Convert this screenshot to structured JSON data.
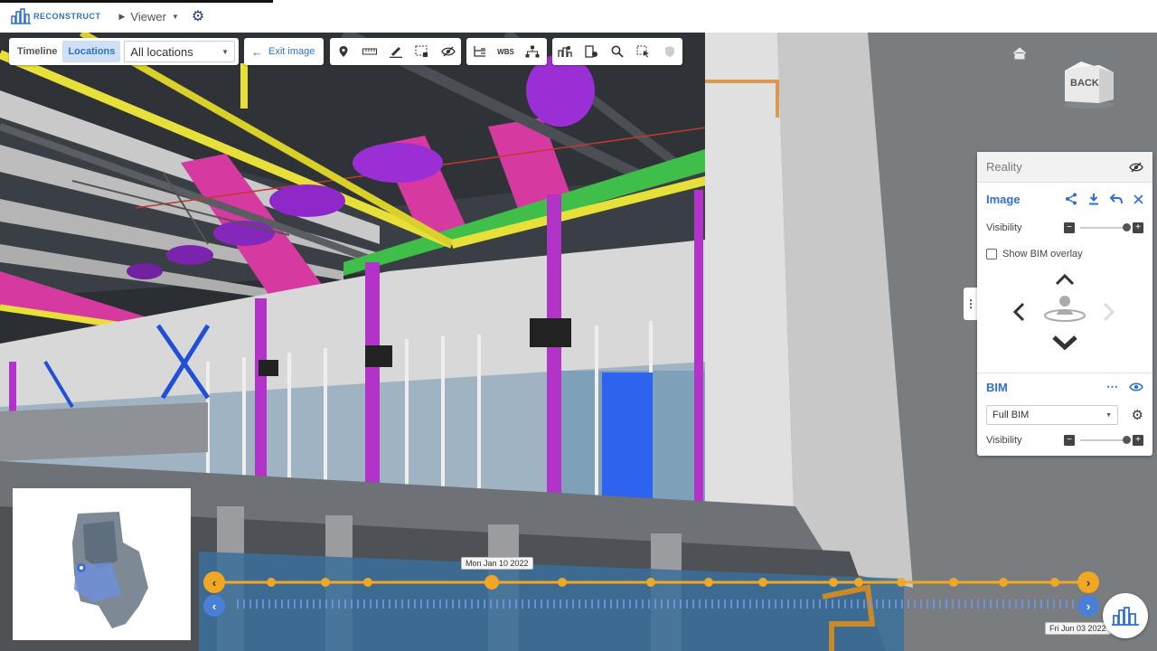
{
  "app": {
    "brand": "RECONSTRUCT",
    "viewer_menu_label": "Viewer",
    "icons": {
      "logo": "building-logo-icon",
      "settings": "gear-icon",
      "viewer": "play-triangle-icon"
    }
  },
  "toolbar": {
    "timeline_tab": "Timeline",
    "locations_tab": "Locations",
    "active_tab": "Locations",
    "location_select": "All locations",
    "exit_image_label": "Exit image",
    "tool_icons": [
      "map-pin-icon",
      "ruler-icon",
      "pencil-icon",
      "select-region-icon",
      "eye-hide-icon",
      "folder-tree-icon",
      "wbs-icon",
      "hierarchy-icon",
      "bim-settings-icon",
      "building-info-icon",
      "search-icon",
      "selection-cursor-icon",
      "shield-disabled-icon"
    ],
    "wbs_text": "WBS"
  },
  "viewcube": {
    "label": "BACK"
  },
  "panel": {
    "reality_title": "Reality",
    "image_title": "Image",
    "visibility_label": "Visibility",
    "show_bim_overlay_label": "Show BIM overlay",
    "show_bim_overlay_checked": false,
    "image_visibility": 1.0,
    "bim_title": "BIM",
    "bim_select": "Full BIM",
    "bim_visibility_label": "Visibility",
    "bim_visibility": 1.0,
    "icons": [
      "eye-hide-icon",
      "share-icon",
      "download-icon",
      "undo-icon",
      "close-icon",
      "more-icon",
      "eye-icon",
      "gear-icon"
    ]
  },
  "timeline": {
    "current_date": "Mon Jan 10 2022",
    "end_date": "Fri Jun 03 2022",
    "colors": {
      "orange": "#f0a723",
      "blue": "#4a7fd6"
    }
  }
}
